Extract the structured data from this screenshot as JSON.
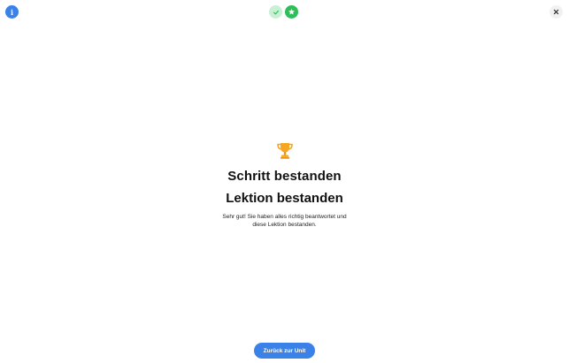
{
  "header": {
    "info_icon": "info-icon",
    "info_glyph": "i",
    "progress_steps": [
      {
        "state": "completed",
        "icon": "check-icon"
      },
      {
        "state": "current",
        "icon": "star-icon"
      }
    ],
    "close_icon": "close-icon"
  },
  "result": {
    "icon": "trophy-icon",
    "title": "Schritt bestanden",
    "subtitle": "Lektion bestanden",
    "message": "Sehr gut! Sie haben alles richtig beantwortet und diese Lektion bestanden."
  },
  "actions": {
    "back_label": "Zurück zur Unit"
  },
  "colors": {
    "primary": "#3b82e8",
    "success": "#2ebd59",
    "success_light": "#c9efd4",
    "trophy": "#f5a623"
  }
}
